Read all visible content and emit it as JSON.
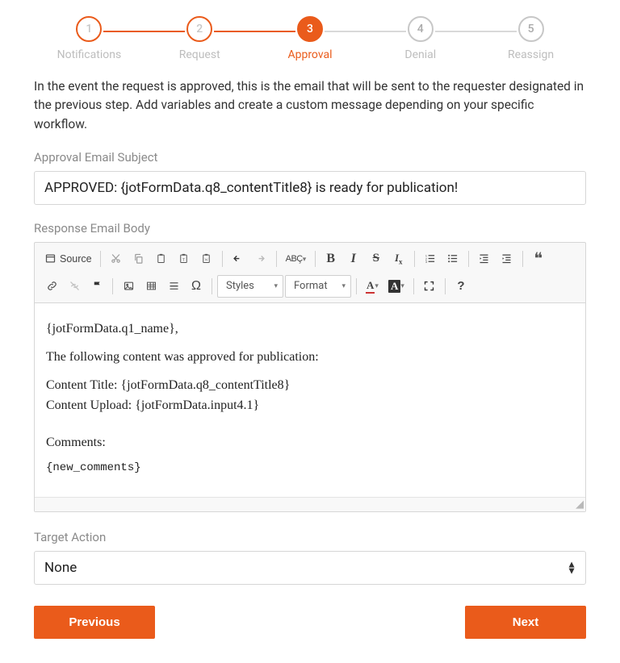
{
  "stepper": {
    "steps": [
      {
        "num": "1",
        "label": "Notifications"
      },
      {
        "num": "2",
        "label": "Request"
      },
      {
        "num": "3",
        "label": "Approval"
      },
      {
        "num": "4",
        "label": "Denial"
      },
      {
        "num": "5",
        "label": "Reassign"
      }
    ],
    "active_index": 2
  },
  "description": "In the event the request is approved, this is the email that will be sent to the requester designated in the previous step. Add variables and create a custom message depending on your specific workflow.",
  "subject": {
    "label": "Approval Email Subject",
    "value": "APPROVED: {jotFormData.q8_contentTitle8} is ready for publication!"
  },
  "body": {
    "label": "Response Email Body",
    "lines": {
      "greeting": "{jotFormData.q1_name},",
      "intro": "The following content was approved for publication:",
      "title_line": "Content Title: {jotFormData.q8_contentTitle8}",
      "upload_line": "Content Upload: {jotFormData.input4.1}",
      "comments_label": "Comments:",
      "comments_var": "{new_comments}"
    }
  },
  "editor_toolbar": {
    "source": "Source",
    "styles_combo": "Styles",
    "format_combo": "Format"
  },
  "target_action": {
    "label": "Target Action",
    "value": "None"
  },
  "buttons": {
    "previous": "Previous",
    "next": "Next"
  }
}
